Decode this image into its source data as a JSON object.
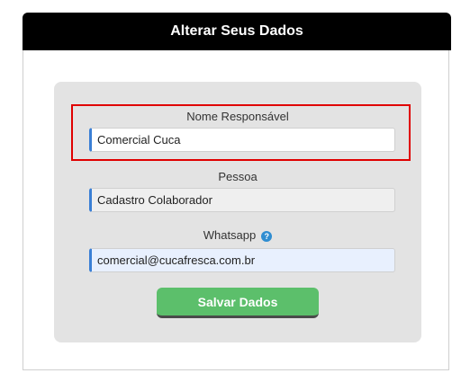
{
  "header": {
    "title": "Alterar Seus Dados"
  },
  "form": {
    "nome": {
      "label": "Nome Responsável",
      "value": "Comercial Cuca"
    },
    "pessoa": {
      "label": "Pessoa",
      "value": "Cadastro Colaborador"
    },
    "whatsapp": {
      "label": "Whatsapp",
      "value": "comercial@cucafresca.com.br",
      "help_icon": "?"
    },
    "save_label": "Salvar Dados"
  },
  "colors": {
    "header_bg": "#000000",
    "button_bg": "#5cbf6b",
    "highlight": "#e00000",
    "field_accent": "#3a7fd5"
  }
}
